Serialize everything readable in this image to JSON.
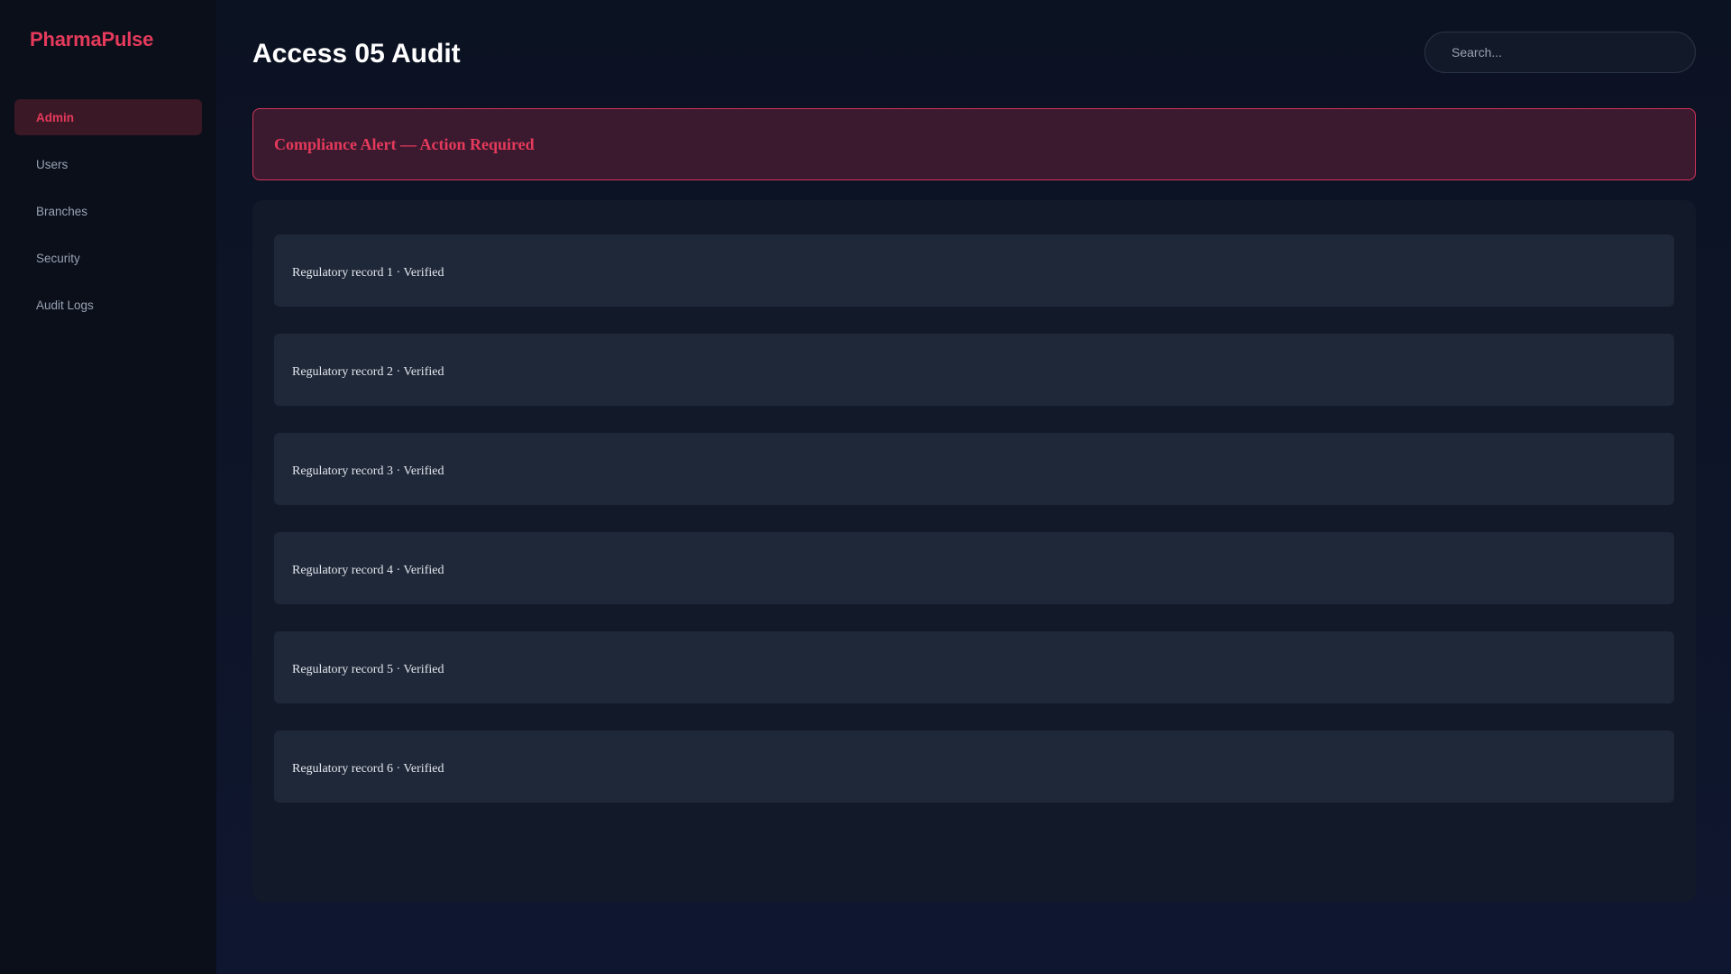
{
  "app": {
    "brand": "PharmaPulse"
  },
  "sidebar": {
    "items": [
      {
        "label": "Admin",
        "active": true
      },
      {
        "label": "Users",
        "active": false
      },
      {
        "label": "Branches",
        "active": false
      },
      {
        "label": "Security",
        "active": false
      },
      {
        "label": "Audit Logs",
        "active": false
      }
    ]
  },
  "header": {
    "title": "Access 05 Audit",
    "search_placeholder": "Search..."
  },
  "alert": {
    "text": "Compliance Alert — Action Required"
  },
  "records": [
    {
      "text": "Regulatory record 1 · Verified"
    },
    {
      "text": "Regulatory record 2 · Verified"
    },
    {
      "text": "Regulatory record 3 · Verified"
    },
    {
      "text": "Regulatory record 4 · Verified"
    },
    {
      "text": "Regulatory record 5 · Verified"
    },
    {
      "text": "Regulatory record 6 · Verified"
    }
  ],
  "colors": {
    "accent": "#e53a5b",
    "sidebar_bg": "#0a0f1a",
    "page_bg": "#0e1424",
    "active_nav_bg": "#3a1826",
    "alert_bg": "#3b1a30",
    "alert_border": "#d3345a",
    "record_bg": "#1f2838"
  }
}
